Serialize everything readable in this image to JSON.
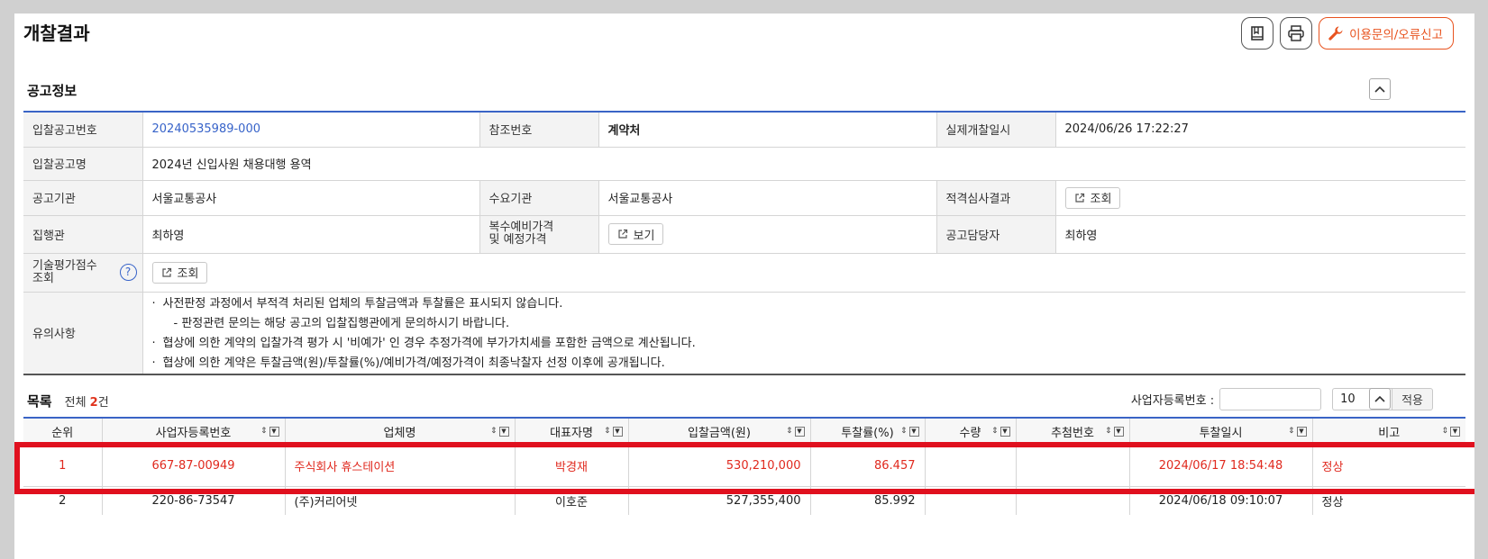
{
  "page": {
    "title": "개찰결과",
    "actions": {
      "inquiry_label": "이용문의/오류신고"
    }
  },
  "notice_info": {
    "section_title": "공고정보",
    "rows": {
      "bid_no_label": "입찰공고번호",
      "bid_no_value": "20240535989-000",
      "ref_no_label": "참조번호",
      "ref_no_value": "계약처",
      "open_date_label": "실제개찰일시",
      "open_date_value": "2024/06/26 17:22:27",
      "bid_name_label": "입찰공고명",
      "bid_name_value": "2024년 신입사원 채용대행 용역",
      "agency_label": "공고기관",
      "agency_value": "서울교통공사",
      "demand_label": "수요기관",
      "demand_value": "서울교통공사",
      "qual_label": "적격심사결과",
      "qual_btn": "조회",
      "exec_label": "집행관",
      "exec_value": "최하영",
      "price_label_1": "복수예비가격",
      "price_label_2": "및 예정가격",
      "price_btn": "보기",
      "manager_label": "공고담당자",
      "manager_value": "최하영",
      "tech_label_1": "기술평가점수",
      "tech_label_2": "조회",
      "tech_btn": "조회",
      "notes_label": "유의사항",
      "notes": [
        "사전판정 과정에서 부적격 처리된 업체의 투찰금액과 투찰률은 표시되지 않습니다.",
        "- 판정관련 문의는 해당 공고의 입찰집행관에게 문의하시기 바랍니다.",
        "협상에 의한 계약의 입찰가격 평가 시 '비예가' 인 경우 추정가격에 부가가치세를 포함한 금액으로 계산됩니다.",
        "협상에 의한 계약은 투찰금액(원)/투찰률(%)/예비가격/예정가격이 최종낙찰자 선정 이후에 공개됩니다."
      ]
    }
  },
  "list": {
    "title": "목록",
    "total_prefix": "전체 ",
    "total_count": "2",
    "total_suffix": "건",
    "filter_label": "사업자등록번호 :",
    "page_size": "10",
    "apply_label": "적용",
    "columns": [
      "순위",
      "사업자등록번호",
      "업체명",
      "대표자명",
      "입찰금액(원)",
      "투찰률(%)",
      "수량",
      "추첨번호",
      "투찰일시",
      "비고"
    ],
    "rows": [
      {
        "rank": "1",
        "biz_no": "667-87-00949",
        "company": "주식회사 휴스테이션",
        "ceo": "박경재",
        "amount": "530,210,000",
        "rate": "86.457",
        "qty": "",
        "draw": "",
        "datetime": "2024/06/17 18:54:48",
        "note": "정상"
      },
      {
        "rank": "2",
        "biz_no": "220-86-73547",
        "company": "(주)커리어넷",
        "ceo": "이호준",
        "amount": "527,355,400",
        "rate": "85.992",
        "qty": "",
        "draw": "",
        "datetime": "2024/06/18 09:10:07",
        "note": "정상"
      }
    ]
  },
  "icons": {
    "bookmark": "bookmark-icon",
    "print": "print-icon",
    "wrench": "wrench-icon",
    "collapse": "chevron-up-icon",
    "external": "external-link-icon",
    "help": "help-icon",
    "sort": "sort-icon",
    "filter": "filter-icon",
    "dropdown": "chevron-down-icon"
  },
  "colors": {
    "accent_blue": "#3a64c6",
    "link_blue": "#3763c9",
    "inquiry_orange": "#e8531f",
    "winner_red": "#e0291e",
    "highlight_red": "#e0101e"
  }
}
